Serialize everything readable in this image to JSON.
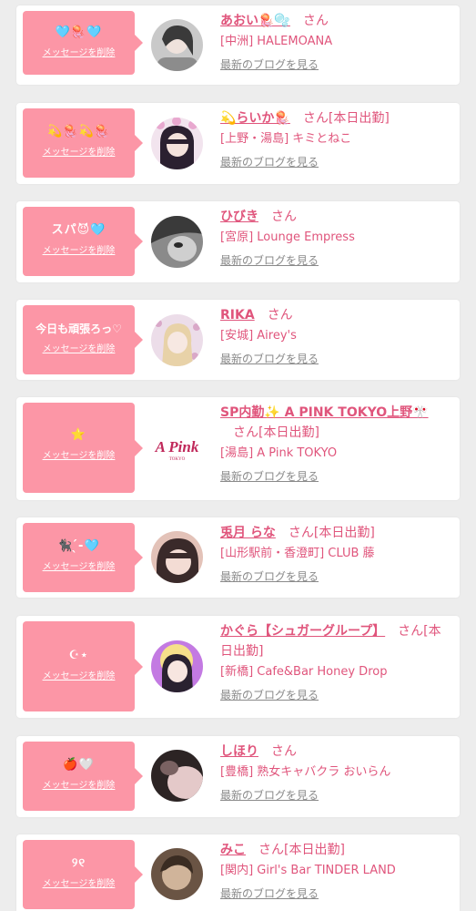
{
  "common": {
    "delete_label": "メッセージを削除",
    "san_label": "さん",
    "blog_label": "最新のブログを見る"
  },
  "cards": [
    {
      "message": "🩵🪼🩵",
      "name": "あおい🪼🫧",
      "suffix": "",
      "shop": "[中洲] HALEMOANA",
      "avatar_colors": [
        "#6d6d6d",
        "#c8c8c8"
      ]
    },
    {
      "message": "💫🪼💫🪼",
      "name": "💫らいか🪼",
      "suffix": "[本日出勤]",
      "shop": "[上野・湯島] キミとねこ",
      "avatar_colors": [
        "#2b2030",
        "#e8b4d8"
      ]
    },
    {
      "message": "スパ😈🩵",
      "name": "ひびき",
      "suffix": "",
      "shop": "[宮原] Lounge Empress",
      "avatar_colors": [
        "#3a3a3a",
        "#9a9a9a"
      ]
    },
    {
      "message": "今日も頑張ろっ♡",
      "name": "RIKA",
      "suffix": "",
      "shop": "[安城] Airey's",
      "avatar_colors": [
        "#e9d6e6",
        "#b28aa8"
      ]
    },
    {
      "message": "⭐",
      "name": "SP内勤✨ A PINK TOKYO上野🎌",
      "suffix": "[本日出勤]",
      "shop": "[湯島] A Pink TOKYO",
      "avatar_colors": [
        "#ffffff",
        "#c0285a"
      ]
    },
    {
      "message": "🐈‍⬛‪‪ ̖́-🩵",
      "name": "兎月 らな",
      "suffix": "[本日出勤]",
      "shop": "[山形駅前・香澄町] CLUB 藤",
      "avatar_colors": [
        "#3a2a2a",
        "#e3c2b8"
      ]
    },
    {
      "message": "☪︎⋆",
      "name": "かぐら【シュガーグループ】",
      "suffix": "[本日出勤]",
      "shop": "[新橋] Cafe&Bar Honey Drop",
      "avatar_colors": [
        "#b85ad8",
        "#f6e08a"
      ]
    },
    {
      "message": "🍎🤍",
      "name": "しほり",
      "suffix": "",
      "shop": "[豊橋] 熟女キャバクラ おいらん",
      "avatar_colors": [
        "#2c2424",
        "#e4c9c9"
      ]
    },
    {
      "message": "୨୧",
      "name": "みこ",
      "suffix": "[本日出勤]",
      "shop": "[関内] Girl's Bar TINDER LAND",
      "avatar_colors": [
        "#4a3a2c",
        "#d0b49a"
      ]
    }
  ]
}
